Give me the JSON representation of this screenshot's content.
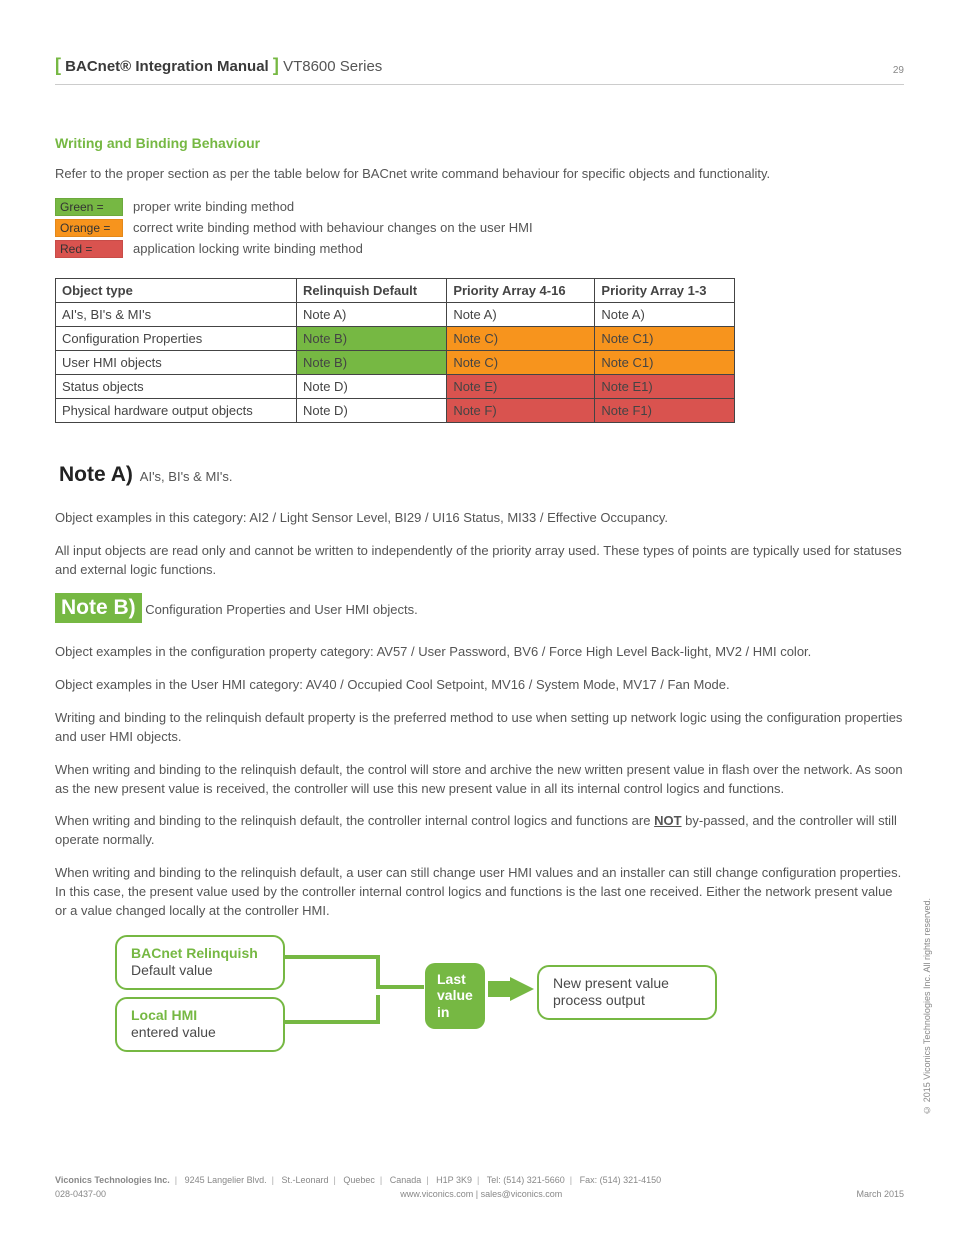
{
  "header": {
    "bracket_l": "[",
    "manual": "BACnet® Integration Manual",
    "bracket_r": "]",
    "series": "VT8600 Series",
    "page": "29"
  },
  "section_title": "Writing and Binding Behaviour",
  "intro": "Refer to the proper section as per the table below for BACnet write command behaviour for specific objects and functionality.",
  "legend": {
    "green": {
      "tag": "Green =",
      "text": "proper write binding method"
    },
    "orange": {
      "tag": "Orange =",
      "text": "correct write binding method with behaviour changes on the user HMI"
    },
    "red": {
      "tag": "Red =",
      "text": "application locking write binding method"
    }
  },
  "table": {
    "headers": [
      "Object type",
      "Relinquish Default",
      "Priority Array 4-16",
      "Priority Array 1-3"
    ],
    "rows": [
      {
        "cells": [
          "AI's, BI's & MI's",
          "Note A)",
          "Note A)",
          "Note A)"
        ],
        "colors": [
          "",
          "",
          "",
          ""
        ]
      },
      {
        "cells": [
          "Configuration Properties",
          "Note B)",
          "Note C)",
          "Note C1)"
        ],
        "colors": [
          "",
          "cell-green",
          "cell-orange",
          "cell-orange"
        ]
      },
      {
        "cells": [
          "User HMI objects",
          "Note B)",
          "Note C)",
          "Note C1)"
        ],
        "colors": [
          "",
          "cell-green",
          "cell-orange",
          "cell-orange"
        ]
      },
      {
        "cells": [
          "Status objects",
          "Note D)",
          "Note E)",
          "Note E1)"
        ],
        "colors": [
          "",
          "",
          "cell-red",
          "cell-red"
        ]
      },
      {
        "cells": [
          "Physical hardware output objects",
          "Note D)",
          "Note F)",
          "Note F1)"
        ],
        "colors": [
          "",
          "",
          "cell-red",
          "cell-red"
        ]
      }
    ]
  },
  "noteA": {
    "label": "Note A)",
    "sub": "AI's, BI's & MI's.",
    "p1": "Object examples in this category: AI2 / Light Sensor Level, BI29 / UI16 Status, MI33 / Effective Occupancy.",
    "p2": "All input objects are read only and cannot be written to independently of the priority array used. These types of points are typically used for statuses and external logic functions."
  },
  "noteB": {
    "label": "Note B)",
    "sub": "Configuration Properties and User HMI objects.",
    "p1": "Object examples in the configuration property category: AV57 / User Password, BV6 / Force High Level Back-light, MV2 / HMI color.",
    "p2": "Object examples in the User HMI category: AV40 / Occupied Cool Setpoint, MV16 / System Mode, MV17 / Fan Mode.",
    "p3": "Writing and binding to the relinquish default property is the preferred method to use when setting up network logic using the configuration properties and user HMI objects.",
    "p4": "When writing and binding to the relinquish default, the control will store and archive the new written present value in flash over the network. As soon as the new present value is received, the controller will use this new present value in all its internal control logics and functions.",
    "p5a": "When writing and binding to the relinquish default, the controller internal control logics and functions are ",
    "p5_not": "NOT",
    "p5b": " by-passed, and the controller will still operate normally.",
    "p6": "When writing and binding to the relinquish default, a user can still change user HMI values and an installer can still change configuration properties. In this case, the present value used by the controller internal control logics and functions is the last one received. Either the network present value or a value changed locally at the controller HMI."
  },
  "diagram": {
    "box1_title": "BACnet Relinquish",
    "box1_sub": "Default value",
    "box2_title": "Local HMI",
    "box2_sub": "entered value",
    "mid": "Last value in",
    "out": "New present value process output"
  },
  "footer": {
    "company": "Viconics Technologies Inc.",
    "addr": "9245 Langelier Blvd.",
    "city": "St.-Leonard",
    "prov": "Quebec",
    "country": "Canada",
    "zip": "H1P 3K9",
    "tel": "Tel: (514) 321-5660",
    "fax": "Fax: (514) 321-4150",
    "doc": "028-0437-00",
    "web": "www.viconics.com",
    "email": "sales@viconics.com",
    "date": "March 2015"
  },
  "copyright": "© 2015 Viconics Technologies Inc. All rights reserved."
}
